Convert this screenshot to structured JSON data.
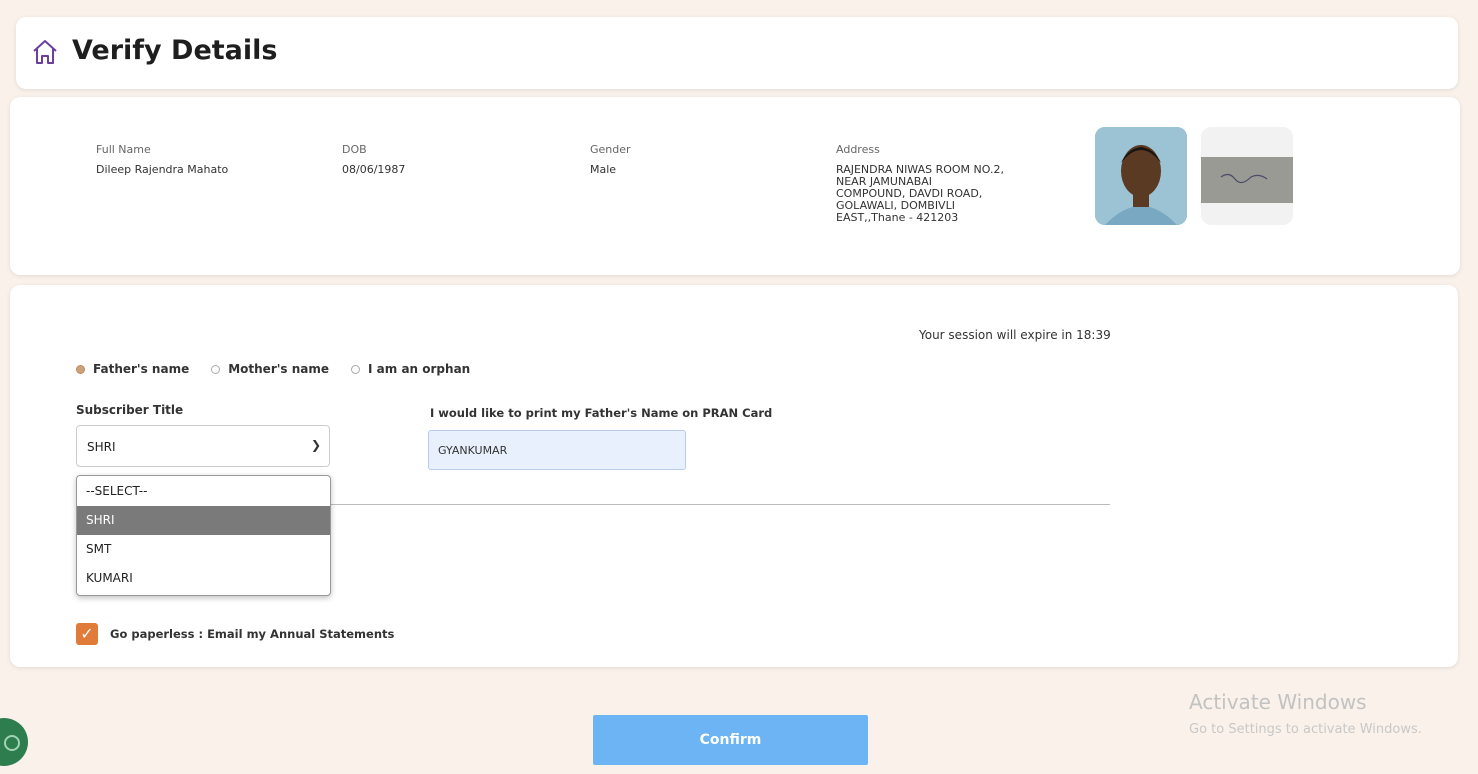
{
  "header": {
    "title": "Verify Details"
  },
  "details": {
    "full_name_label": "Full Name",
    "full_name": "Dileep Rajendra Mahato",
    "dob_label": "DOB",
    "dob": "08/06/1987",
    "gender_label": "Gender",
    "gender": "Male",
    "address_label": "Address",
    "address_lines": [
      "RAJENDRA NIWAS ROOM NO.2,",
      "NEAR JAMUNABAI",
      "COMPOUND, DAVDI ROAD,",
      "GOLAWALI, DOMBIVLI",
      "EAST,,Thane - 421203"
    ]
  },
  "form": {
    "session_text": "Your session will expire in 18:39",
    "radios": [
      {
        "label": "Father's name",
        "selected": true
      },
      {
        "label": "Mother's name",
        "selected": false
      },
      {
        "label": "I am an orphan",
        "selected": false
      }
    ],
    "subscriber_title_label": "Subscriber Title",
    "subscriber_title_value": "SHRI",
    "print_label": "I would like to print my Father's Name on PRAN Card",
    "print_value": "GYANKUMAR",
    "dropdown_options": [
      "--SELECT--",
      "SHRI",
      "SMT",
      "KUMARI"
    ],
    "dropdown_selected": "SHRI",
    "paperless_label": "Go paperless : Email my Annual Statements",
    "paperless_checked": true
  },
  "confirm_label": "Confirm",
  "watermark": {
    "line1": "Activate Windows",
    "line2": "Go to Settings to activate Windows."
  },
  "colors": {
    "accent_orange": "#e07b3a",
    "confirm_blue": "#6cb4f4",
    "background": "#f9f1ea"
  }
}
